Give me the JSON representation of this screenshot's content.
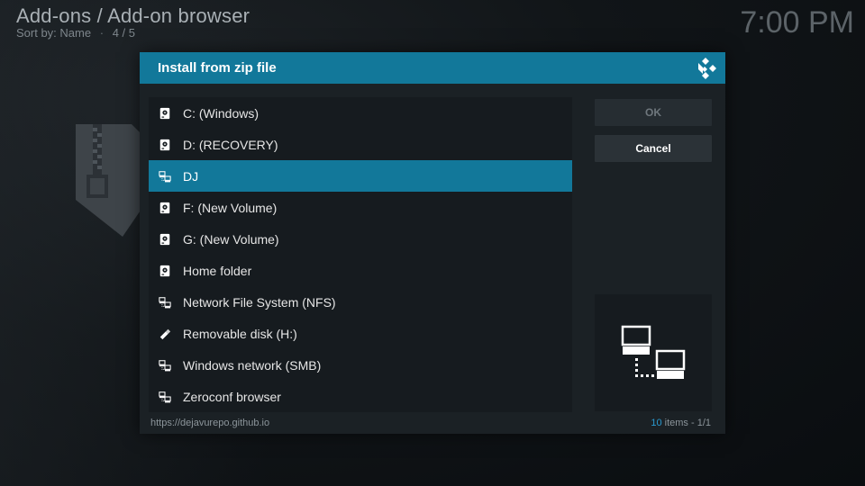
{
  "header": {
    "title": "Add-ons / Add-on browser",
    "sort_label": "Sort by: Name",
    "position": "4 / 5",
    "separator": "·",
    "clock": "7:00 PM"
  },
  "dialog": {
    "title": "Install from zip file",
    "ok_label": "OK",
    "cancel_label": "Cancel",
    "footer_url": "https://dejavurepo.github.io",
    "count_number": "10",
    "count_text": " items - 1/1",
    "items": [
      {
        "label": "C: (Windows)",
        "icon": "hard-drive-icon",
        "selected": false
      },
      {
        "label": "D: (RECOVERY)",
        "icon": "hard-drive-icon",
        "selected": false
      },
      {
        "label": "DJ",
        "icon": "network-icon",
        "selected": true
      },
      {
        "label": "F: (New Volume)",
        "icon": "hard-drive-icon",
        "selected": false
      },
      {
        "label": "G: (New Volume)",
        "icon": "hard-drive-icon",
        "selected": false
      },
      {
        "label": "Home folder",
        "icon": "hard-drive-icon",
        "selected": false
      },
      {
        "label": "Network File System (NFS)",
        "icon": "network-icon",
        "selected": false
      },
      {
        "label": "Removable disk (H:)",
        "icon": "usb-icon",
        "selected": false
      },
      {
        "label": "Windows network (SMB)",
        "icon": "network-icon",
        "selected": false
      },
      {
        "label": "Zeroconf browser",
        "icon": "network-icon",
        "selected": false
      }
    ]
  },
  "colors": {
    "accent": "#12789a",
    "count_highlight": "#2a9ad0"
  }
}
